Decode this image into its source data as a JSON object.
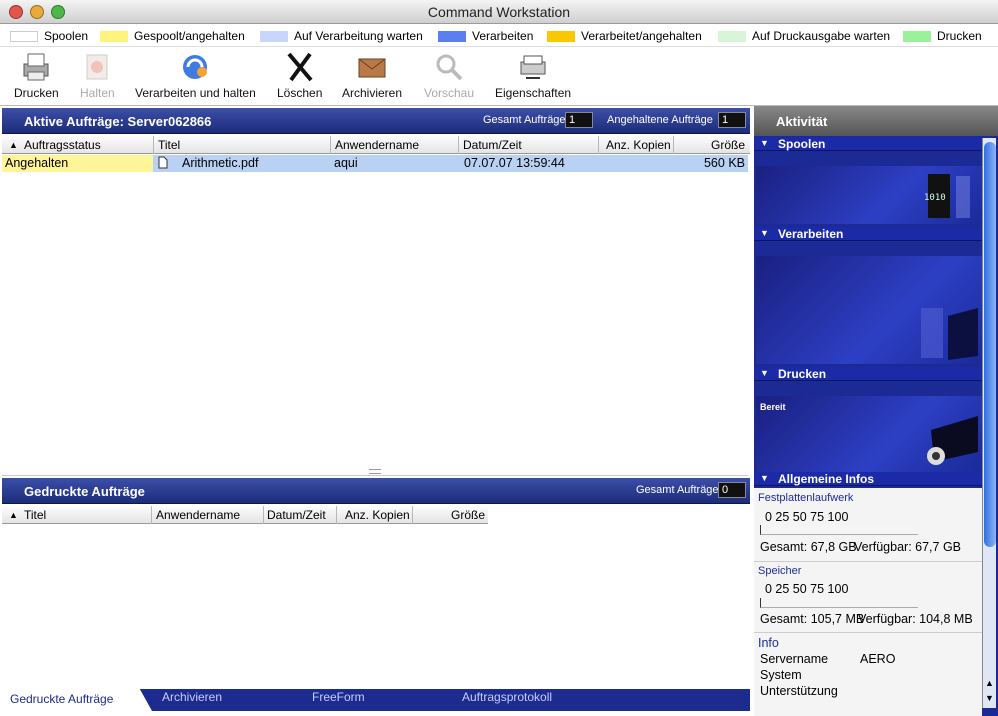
{
  "window": {
    "title": "Command Workstation"
  },
  "legend": [
    {
      "label": "Spoolen",
      "color": "#ffffff"
    },
    {
      "label": "Gespoolt/angehalten",
      "color": "#fef37c"
    },
    {
      "label": "Auf Verarbeitung warten",
      "color": "#c9d6fb"
    },
    {
      "label": "Verarbeiten",
      "color": "#5b7ef0"
    },
    {
      "label": "Verarbeitet/angehalten",
      "color": "#f9c800"
    },
    {
      "label": "Auf Druckausgabe warten",
      "color": "#d7f5d8"
    },
    {
      "label": "Drucken",
      "color": "#9cf09a"
    }
  ],
  "toolbar": {
    "print": "Drucken",
    "hold": "Halten",
    "process_hold": "Verarbeiten und halten",
    "delete": "Löschen",
    "archive": "Archivieren",
    "preview": "Vorschau",
    "properties": "Eigenschaften"
  },
  "active": {
    "title": "Aktive Aufträge: Server062866",
    "total_label": "Gesamt Aufträge",
    "total_value": "1",
    "held_label": "Angehaltene Aufträge",
    "held_value": "1",
    "columns": [
      "Auftragsstatus",
      "Titel",
      "Anwendername",
      "Datum/Zeit",
      "Anz. Kopien",
      "Größe"
    ],
    "row": {
      "status": "Angehalten",
      "title": "Arithmetic.pdf",
      "user": "aqui",
      "date": "07.07.07 13:59:44",
      "copies": "",
      "size": "560 KB"
    }
  },
  "printed": {
    "title": "Gedruckte Aufträge",
    "total_label": "Gesamt Aufträge",
    "total_value": "0",
    "columns": [
      "Titel",
      "Anwendername",
      "Datum/Zeit",
      "Anz. Kopien",
      "Größe"
    ]
  },
  "tabs": [
    "Gedruckte Aufträge",
    "Archivieren",
    "FreeForm",
    "Auftragsprotokoll"
  ],
  "activity": {
    "title": "Aktivität",
    "spool": "Spoolen",
    "process": "Verarbeiten",
    "print": "Drucken",
    "print_status": "Bereit",
    "info": "Allgemeine Infos",
    "disk_label": "Festplattenlaufwerk",
    "scale": "0     25     50     75     100",
    "disk_total": "Gesamt: 67,8 GB",
    "disk_free": "Verfügbar: 67,7 GB",
    "mem_label": "Speicher",
    "mem_total": "Gesamt: 105,7 MB",
    "mem_free": "Verfügbar: 104,8 MB",
    "info_label": "Info",
    "server_label": "Servername",
    "server_value": "AERO",
    "system_label": "System",
    "support_label": "Unterstützung"
  }
}
